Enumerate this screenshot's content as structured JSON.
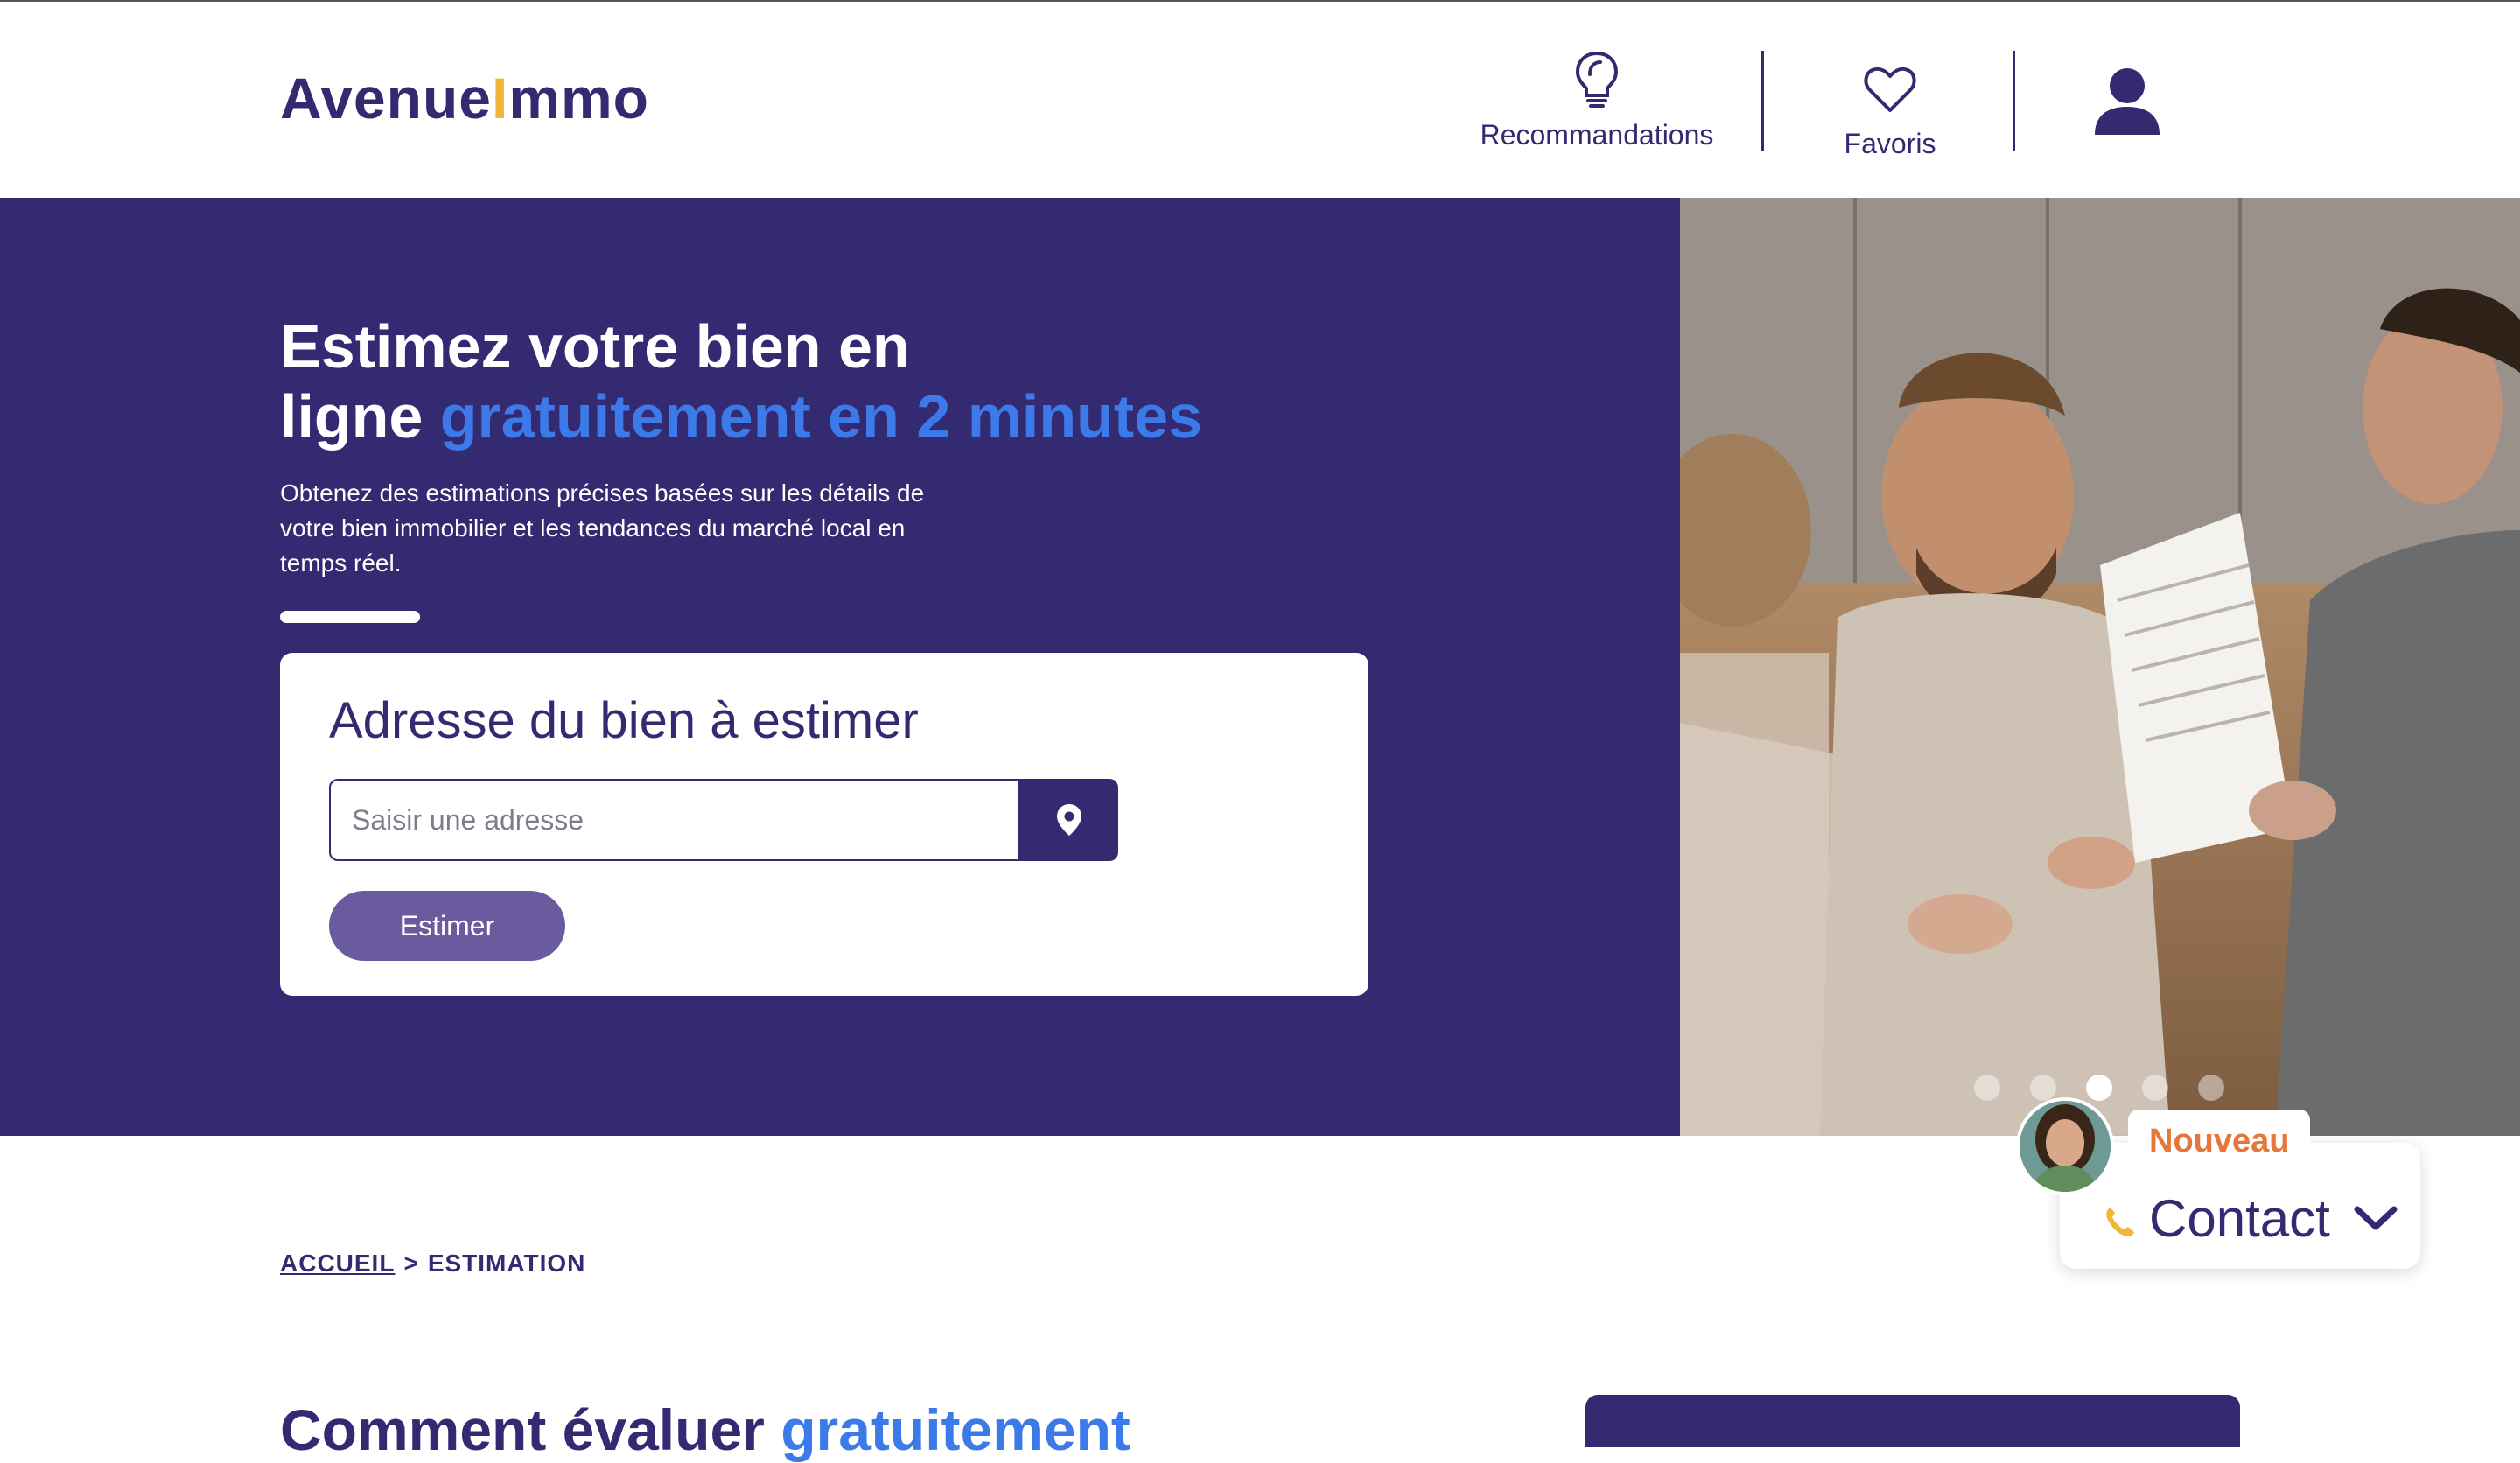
{
  "header": {
    "logo_part1": "Avenue",
    "logo_part2": "I",
    "logo_part3": "mmo",
    "nav": {
      "recommendations_label": "Recommandations",
      "favorites_label": "Favoris"
    }
  },
  "hero": {
    "title_line1": "Estimez votre bien en",
    "title_line2_plain": "ligne ",
    "title_line2_accent": "gratuitement en 2 minutes",
    "subtitle": "Obtenez des estimations précises basées sur les détails de votre bien immobilier et les tendances du marché local en temps réel.",
    "form": {
      "title": "Adresse du bien à estimer",
      "address_placeholder": "Saisir une adresse",
      "submit_label": "Estimer"
    },
    "carousel": {
      "slide_count": 5,
      "active_index": 2
    }
  },
  "contact_widget": {
    "badge": "Nouveau",
    "label": "Contact"
  },
  "breadcrumb": {
    "home": "ACCUEIL",
    "separator": ">",
    "current": "ESTIMATION"
  },
  "section": {
    "title_plain": "Comment évaluer ",
    "title_accent": "gratuitement"
  },
  "colors": {
    "primary": "#342a72",
    "accent_blue": "#3b7ae8",
    "accent_orange": "#e8763a",
    "logo_yellow": "#f4b63a",
    "button_purple": "#6a5b9e"
  }
}
